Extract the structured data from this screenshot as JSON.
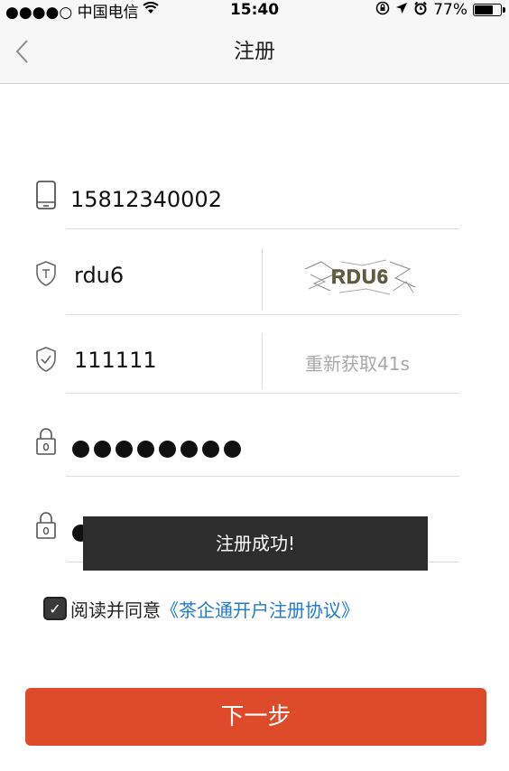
{
  "status_bar": {
    "carrier": "●●●●○ 中国电信",
    "time": "15:40",
    "battery": "77%",
    "battery_level": 0.77
  },
  "nav": {
    "title": "注册",
    "back_icon": "chevron-left-icon"
  },
  "form": {
    "phone": "15812340002",
    "captcha_input": "rdu6",
    "captcha_image_text": "RDU6",
    "sms_code": "111111",
    "resend_label": "重新获取41s",
    "password_mask_count": 8
  },
  "toast": {
    "message": "注册成功!"
  },
  "agreement": {
    "checked": true,
    "text": "阅读并同意",
    "link": "《茶企通开户注册协议》"
  },
  "buttons": {
    "next": "下一步"
  },
  "colors": {
    "primary": "#de4b2b",
    "link": "#1f7ad6",
    "toast_bg": "#2d2d2d"
  }
}
